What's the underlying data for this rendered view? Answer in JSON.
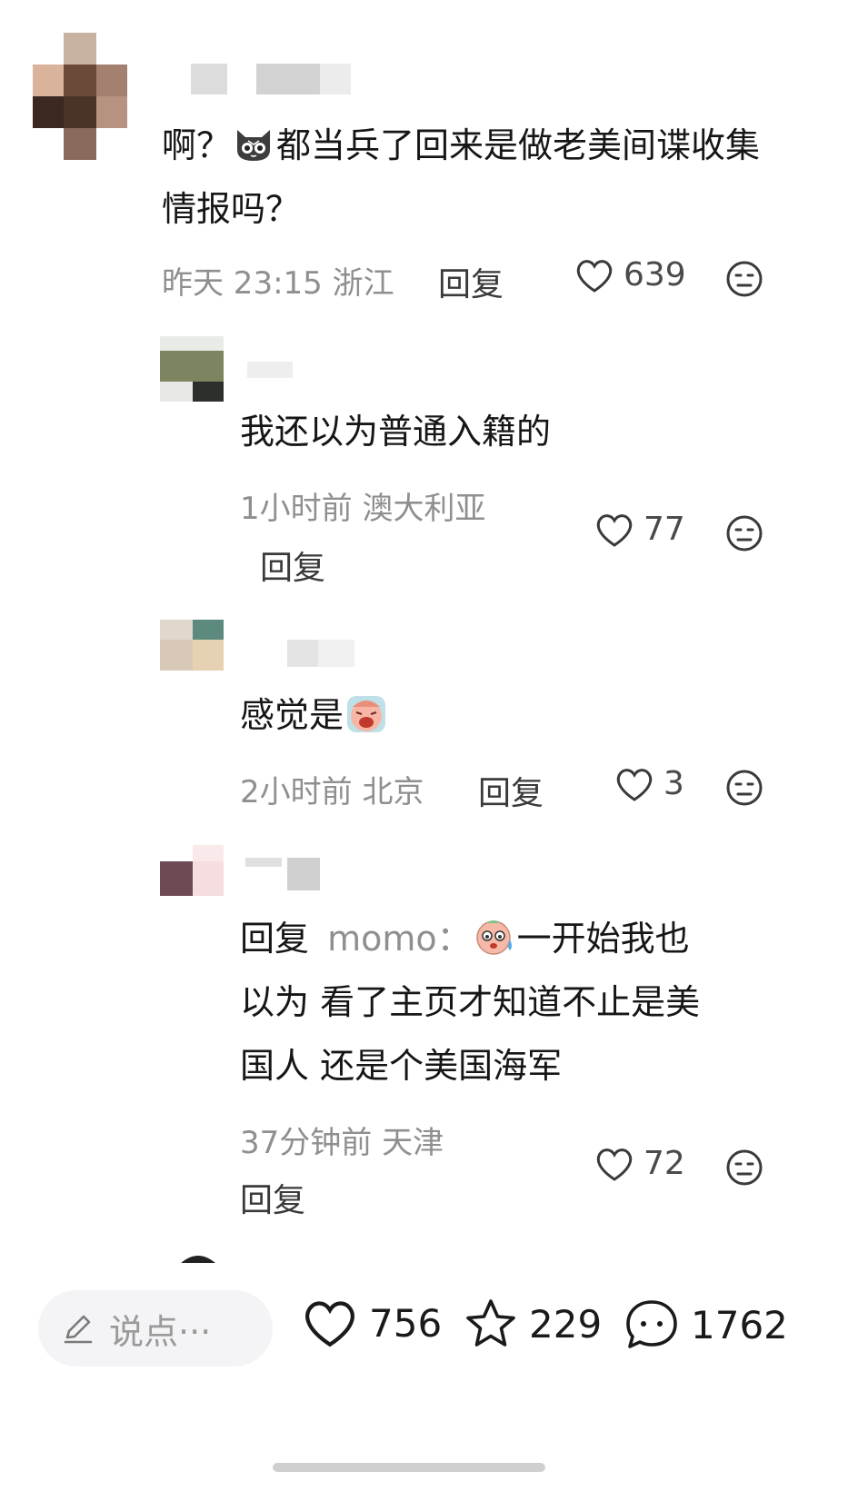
{
  "comments": [
    {
      "text_before_emoji": "啊？",
      "emoji": "cat-face-icon",
      "text_after_emoji": "都当兵了回来是做老美间谍收集情报吗？",
      "time": "昨天 23:15",
      "location": "浙江",
      "reply_label": "回复",
      "likes": "639"
    },
    {
      "text": "我还以为普通入籍的",
      "time": "1小时前",
      "location": "澳大利亚",
      "reply_label": "回复",
      "likes": "77"
    },
    {
      "text": "感觉是",
      "emoji": "facepalm-emoji-icon",
      "time": "2小时前",
      "location": "北京",
      "reply_label": "回复",
      "likes": "3"
    },
    {
      "reply_prefix": "回复",
      "reply_to": "momo",
      "reply_colon": "：",
      "emoji": "sweat-face-emoji-icon",
      "text_line1": "一开始我也",
      "text_line2": "以为 看了主页才知道不止是美",
      "text_line3": "国人 还是个美国海军",
      "time": "37分钟前",
      "location": "天津",
      "reply_label": "回复",
      "likes": "72"
    }
  ],
  "bottom_bar": {
    "input_placeholder": "说点···",
    "likes": "756",
    "favorites": "229",
    "comments": "1762"
  },
  "colors": {
    "meta": "#8f8f8f",
    "text": "#161616",
    "input_bg": "#f4f4f6"
  }
}
